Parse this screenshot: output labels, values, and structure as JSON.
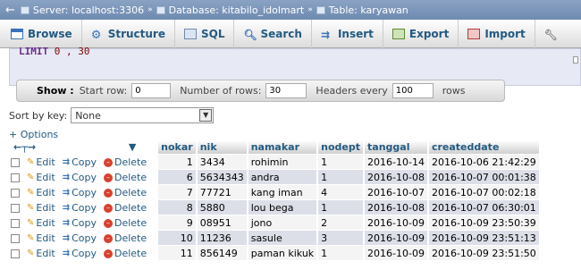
{
  "breadcrumb": {
    "server": "Server: localhost:3306",
    "database": "Database: kitabilo_idolmart",
    "table": "Table: karyawan",
    "separator": "»"
  },
  "tabs": [
    {
      "label": "Browse",
      "icon": "browse-icon"
    },
    {
      "label": "Structure",
      "icon": "structure-icon"
    },
    {
      "label": "SQL",
      "icon": "sql-icon"
    },
    {
      "label": "Search",
      "icon": "search-icon"
    },
    {
      "label": "Insert",
      "icon": "insert-icon"
    },
    {
      "label": "Export",
      "icon": "export-icon"
    },
    {
      "label": "Import",
      "icon": "import-icon"
    }
  ],
  "sql": {
    "keyword": "LIMIT",
    "offset": "0",
    "sep": ",",
    "limit": "30"
  },
  "nav": {
    "show_label": "Show :",
    "start_row_label": "Start row:",
    "start_row_value": "0",
    "rows_label": "Number of rows:",
    "rows_value": "30",
    "headers_label": "Headers every",
    "headers_value": "100",
    "rows_suffix": "rows"
  },
  "sort": {
    "label": "Sort by key:",
    "value": "None"
  },
  "options_label": "+ Options",
  "columns": [
    "nokar",
    "nik",
    "namakar",
    "nodept",
    "tanggal",
    "createddate"
  ],
  "actions": {
    "edit": "Edit",
    "copy": "Copy",
    "delete": "Delete"
  },
  "rows": [
    [
      "1",
      "3434",
      "rohimin",
      "1",
      "2016-10-14",
      "2016-10-06 21:42:29"
    ],
    [
      "6",
      "5634343",
      "andra",
      "1",
      "2016-10-08",
      "2016-10-07 00:01:38"
    ],
    [
      "7",
      "77721",
      "kang iman",
      "4",
      "2016-10-07",
      "2016-10-07 00:02:18"
    ],
    [
      "8",
      "5880",
      "lou bega",
      "1",
      "2016-10-08",
      "2016-10-07 06:30:01"
    ],
    [
      "9",
      "08951",
      "jono",
      "2",
      "2016-10-09",
      "2016-10-09 23:50:39"
    ],
    [
      "10",
      "11236",
      "sasule",
      "3",
      "2016-10-09",
      "2016-10-09 23:51:13"
    ],
    [
      "11",
      "856149",
      "paman kikuk",
      "1",
      "2016-10-09",
      "2016-10-09 23:51:50"
    ]
  ]
}
